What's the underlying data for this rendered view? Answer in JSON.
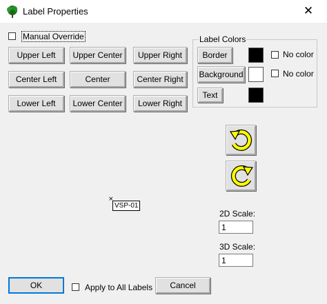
{
  "window": {
    "title": "Label Properties",
    "close_glyph": "✕",
    "app_icon": "tree-icon"
  },
  "manual_override": {
    "label": "Manual Override",
    "checked": false
  },
  "position_buttons": {
    "upper_left": "Upper Left",
    "upper_center": "Upper Center",
    "upper_right": "Upper Right",
    "center_left": "Center Left",
    "center": "Center",
    "center_right": "Center Right",
    "lower_left": "Lower Left",
    "lower_center": "Lower Center",
    "lower_right": "Lower Right"
  },
  "label_colors": {
    "title": "Label Colors",
    "border_button": "Border",
    "background_button": "Background",
    "text_button": "Text",
    "no_color_label": "No color",
    "border_no_color_checked": false,
    "background_no_color_checked": false,
    "border_color": "#000000",
    "background_color": "#ffffff",
    "text_color": "#000000"
  },
  "rotation": {
    "ccw_icon": "rotate-counterclockwise-icon",
    "cw_icon": "rotate-clockwise-icon",
    "icon_color": "#ffff00"
  },
  "preview": {
    "label_text": "VSP-01",
    "anchor_glyph": "×"
  },
  "scale_2d": {
    "label": "2D Scale:",
    "value": "1"
  },
  "scale_3d": {
    "label": "3D Scale:",
    "value": "1"
  },
  "footer": {
    "ok_button": "OK",
    "apply_all_label": "Apply to All Labels",
    "apply_all_checked": false,
    "cancel_button": "Cancel"
  }
}
